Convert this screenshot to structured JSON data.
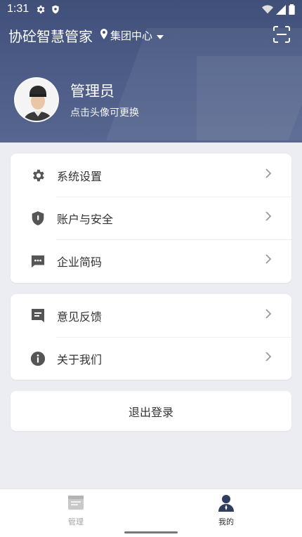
{
  "status_bar": {
    "time": "1:31"
  },
  "header": {
    "app_title": "协砼智慧管家",
    "location": "集团中心"
  },
  "profile": {
    "name": "管理员",
    "subtitle": "点击头像可更换"
  },
  "menu_group_1": [
    {
      "label": "系统设置",
      "icon": "gear-icon"
    },
    {
      "label": "账户与安全",
      "icon": "shield-icon"
    },
    {
      "label": "企业简码",
      "icon": "message-dots-icon"
    }
  ],
  "menu_group_2": [
    {
      "label": "意见反馈",
      "icon": "feedback-icon"
    },
    {
      "label": "关于我们",
      "icon": "info-icon"
    }
  ],
  "logout_label": "退出登录",
  "tabs": [
    {
      "label": "管理",
      "active": false
    },
    {
      "label": "我的",
      "active": true
    }
  ],
  "colors": {
    "header_bg": "#455582",
    "page_bg": "#ecedf3",
    "icon_gray": "#555555",
    "active_tab": "#2f3e5f"
  }
}
